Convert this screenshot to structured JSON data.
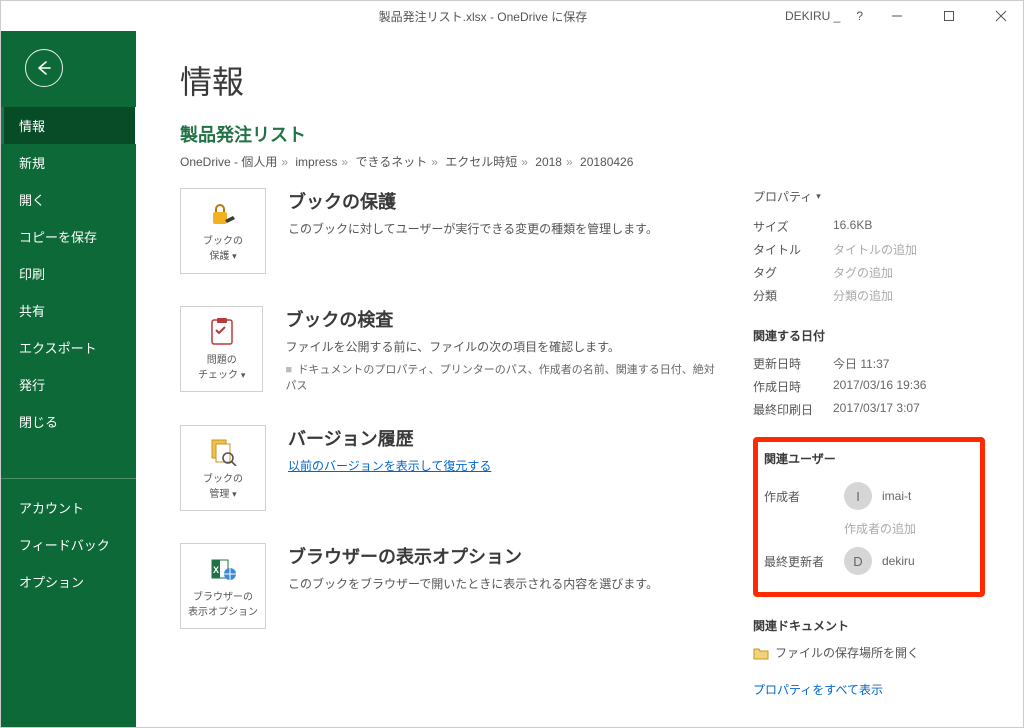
{
  "titlebar": {
    "filename": "製品発注リスト.xlsx - OneDrive に保存",
    "user": "DEKIRU _",
    "help": "?"
  },
  "sidebar": {
    "items": [
      "情報",
      "新規",
      "開く",
      "コピーを保存",
      "印刷",
      "共有",
      "エクスポート",
      "発行",
      "閉じる"
    ],
    "footer": [
      "アカウント",
      "フィードバック",
      "オプション"
    ]
  },
  "page": {
    "title": "情報",
    "fileName": "製品発注リスト",
    "breadcrumb": [
      "OneDrive - 個人用",
      "impress",
      "できるネット",
      "エクセル時短",
      "2018",
      "20180426"
    ]
  },
  "sections": {
    "protect": {
      "tile_line1": "ブックの",
      "tile_line2": "保護",
      "title": "ブックの保護",
      "desc": "このブックに対してユーザーが実行できる変更の種類を管理します。"
    },
    "inspect": {
      "tile_line1": "問題の",
      "tile_line2": "チェック",
      "title": "ブックの検査",
      "desc": "ファイルを公開する前に、ファイルの次の項目を確認します。",
      "item": "ドキュメントのプロパティ、プリンターのパス、作成者の名前、関連する日付、絶対パス"
    },
    "versions": {
      "tile_line1": "ブックの",
      "tile_line2": "管理",
      "title": "バージョン履歴",
      "link": "以前のバージョンを表示して復元する"
    },
    "browser": {
      "tile_line1": "ブラウザーの",
      "tile_line2": "表示オプション",
      "title": "ブラウザーの表示オプション",
      "desc": "このブックをブラウザーで開いたときに表示される内容を選びます。"
    }
  },
  "props": {
    "header": "プロパティ",
    "size_k": "サイズ",
    "size_v": "16.6KB",
    "title_k": "タイトル",
    "title_v": "タイトルの追加",
    "tag_k": "タグ",
    "tag_v": "タグの追加",
    "cat_k": "分類",
    "cat_v": "分類の追加",
    "dates_header": "関連する日付",
    "modified_k": "更新日時",
    "modified_v": "今日 11:37",
    "created_k": "作成日時",
    "created_v": "2017/03/16 19:36",
    "printed_k": "最終印刷日",
    "printed_v": "2017/03/17 3:07",
    "users_header": "関連ユーザー",
    "author_k": "作成者",
    "author_initial": "I",
    "author_name": "imai-t",
    "add_author": "作成者の追加",
    "lastmod_k": "最終更新者",
    "lastmod_initial": "D",
    "lastmod_name": "dekiru",
    "docs_header": "関連ドキュメント",
    "open_location": "ファイルの保存場所を開く",
    "show_all": "プロパティをすべて表示"
  }
}
